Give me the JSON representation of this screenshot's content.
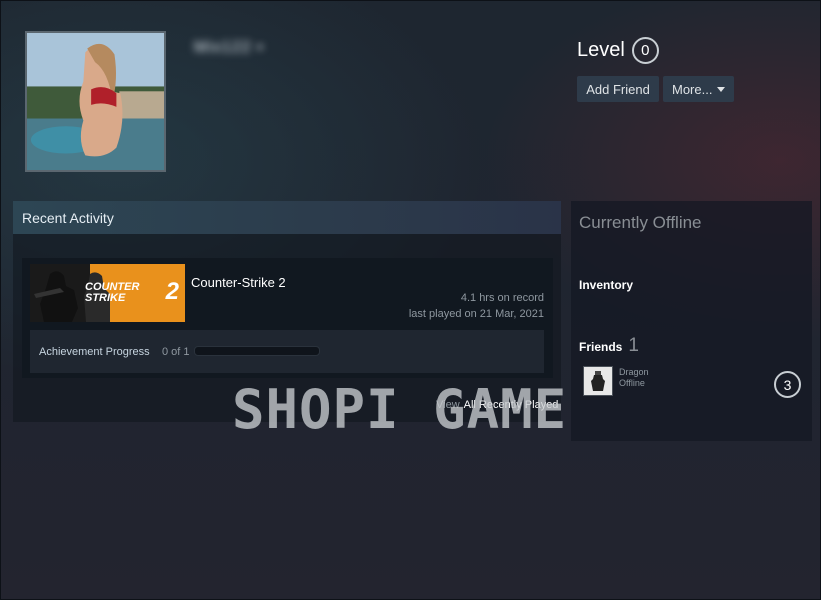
{
  "profile": {
    "persona_name": "Mix122 ▪",
    "level_label": "Level",
    "level_value": "0",
    "add_friend_label": "Add Friend",
    "more_label": "More..."
  },
  "recent_activity": {
    "title": "Recent Activity",
    "game": {
      "name": "Counter-Strike 2",
      "capsule_logo_text": "COUNTER STRIKE",
      "capsule_number": "2",
      "hours": "4.1 hrs on record",
      "last_played": "last played on 21 Mar, 2021",
      "achievement_label": "Achievement Progress",
      "achievement_count": "0 of 1",
      "achievement_progress": 0
    },
    "view_label": "View",
    "view_link": "All Recently Played"
  },
  "sidebar": {
    "status": "Currently Offline",
    "inventory_label": "Inventory",
    "friends_label": "Friends",
    "friends_count": "1",
    "friend": {
      "name": "Dragon",
      "status": "Offline"
    },
    "more_count": "3"
  },
  "watermark": "SHOPI GAME",
  "colors": {
    "accent_orange": "#e9911c",
    "button_bg": "#2e3b4a",
    "header_bg": "#2d4654"
  }
}
